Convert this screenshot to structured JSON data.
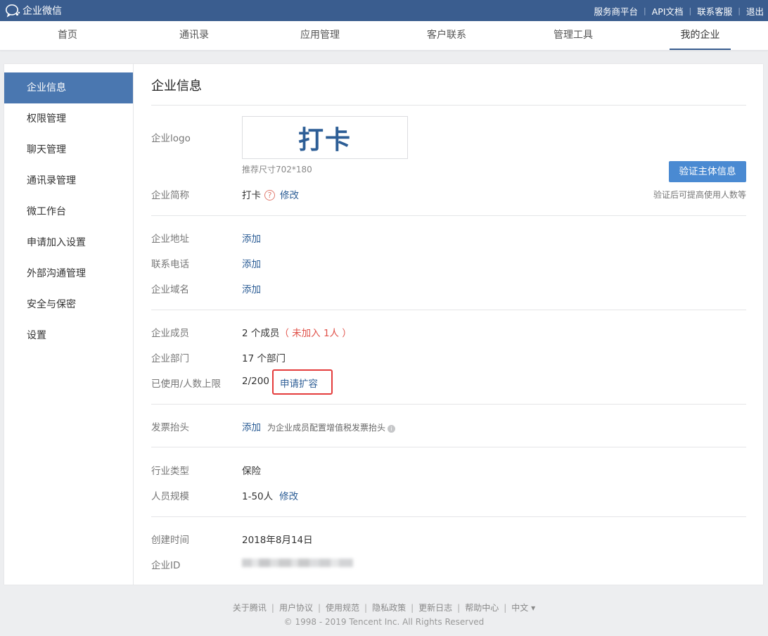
{
  "topbar": {
    "brand": "企业微信",
    "links": [
      "服务商平台",
      "API文档",
      "联系客服",
      "退出"
    ]
  },
  "nav": {
    "tabs": [
      "首页",
      "通讯录",
      "应用管理",
      "客户联系",
      "管理工具",
      "我的企业"
    ],
    "active": "我的企业"
  },
  "sidebar": {
    "items": [
      "企业信息",
      "权限管理",
      "聊天管理",
      "通讯录管理",
      "微工作台",
      "申请加入设置",
      "外部沟通管理",
      "安全与保密",
      "设置"
    ],
    "active": "企业信息"
  },
  "content": {
    "title": "企业信息",
    "logo": {
      "label": "企业logo",
      "text": "打卡",
      "hint": "推荐尺寸702*180"
    },
    "verify": {
      "button": "验证主体信息",
      "note": "验证后可提高使用人数等"
    },
    "short_name": {
      "label": "企业简称",
      "value": "打卡",
      "help": "?",
      "action": "修改"
    },
    "address": {
      "label": "企业地址",
      "action": "添加"
    },
    "phone": {
      "label": "联系电话",
      "action": "添加"
    },
    "domain": {
      "label": "企业域名",
      "action": "添加"
    },
    "members": {
      "label": "企业成员",
      "value": "2 个成员",
      "not_joined": "（ 未加入 1人 ）"
    },
    "departments": {
      "label": "企业部门",
      "value": "17 个部门"
    },
    "usage": {
      "label": "已使用/人数上限",
      "value": "2/200",
      "action": "申请扩容"
    },
    "invoice": {
      "label": "发票抬头",
      "action": "添加",
      "note": "为企业成员配置增值税发票抬头",
      "info": "i"
    },
    "industry": {
      "label": "行业类型",
      "value": "保险"
    },
    "scale": {
      "label": "人员规模",
      "value": "1-50人",
      "action": "修改"
    },
    "created": {
      "label": "创建时间",
      "value": "2018年8月14日"
    },
    "corp_id": {
      "label": "企业ID"
    }
  },
  "footer": {
    "links": [
      "关于腾讯",
      "用户协议",
      "使用规范",
      "隐私政策",
      "更新日志",
      "帮助中心",
      "中文 ▾"
    ],
    "copyright": "© 1998 - 2019 Tencent Inc. All Rights Reserved"
  },
  "colors": {
    "topbar": "#3a5d8f",
    "accent": "#4a77b0",
    "link": "#2d5e96",
    "button": "#4a8ad2",
    "highlight_box": "#e43c3c",
    "warning_text": "#e0524a"
  }
}
